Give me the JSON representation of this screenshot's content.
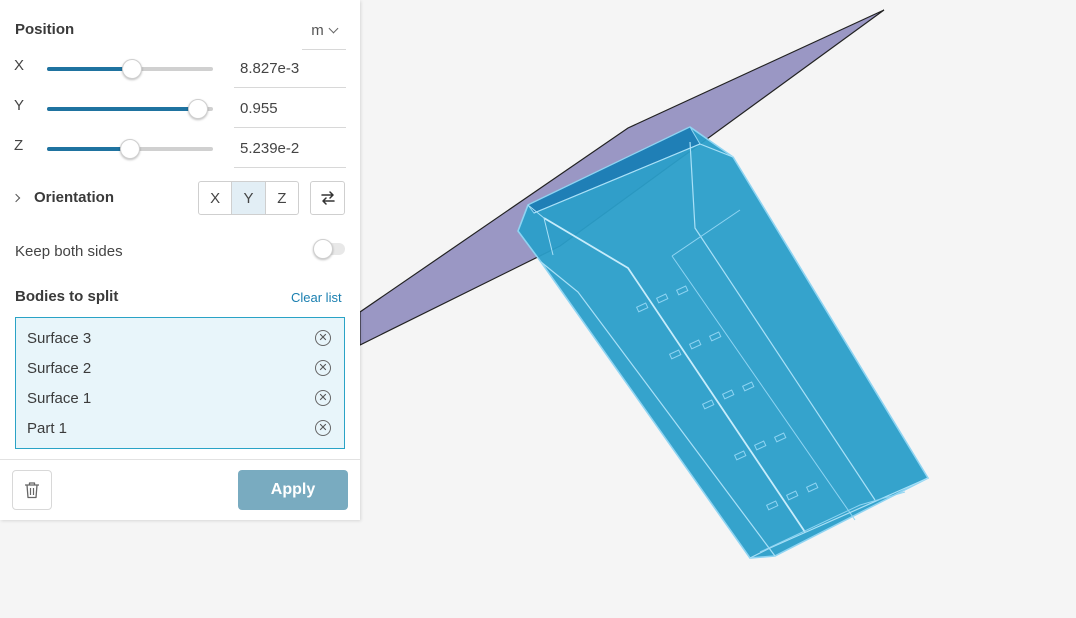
{
  "panel": {
    "position_title": "Position",
    "unit": "m",
    "axes": [
      {
        "label": "X",
        "value": "8.827e-3",
        "slider_fraction": 0.51
      },
      {
        "label": "Y",
        "value": "0.955",
        "slider_fraction": 0.91
      },
      {
        "label": "Z",
        "value": "5.239e-2",
        "slider_fraction": 0.5
      }
    ],
    "orientation": {
      "title": "Orientation",
      "options": [
        "X",
        "Y",
        "Z"
      ],
      "selected": "Y"
    },
    "keep_both_sides": {
      "label": "Keep both sides",
      "enabled": false
    },
    "bodies": {
      "title": "Bodies to split",
      "clear_label": "Clear list",
      "items": [
        "Surface 3",
        "Surface 2",
        "Surface 1",
        "Part 1"
      ]
    },
    "apply_label": "Apply"
  },
  "colors": {
    "accent": "#1f73a0",
    "apply_button": "#79abc0",
    "plane_fill": "#9a97c4",
    "body_fill": "#2a9ec9",
    "list_border": "#2aa3c6",
    "list_bg": "#e8f5fa"
  },
  "icons": {
    "unit_dropdown": "chevron-down-icon",
    "orientation_toggle": "chevron-right-icon",
    "flip": "swap-arrows-icon",
    "remove": "close-circle-icon",
    "delete": "trash-icon"
  }
}
